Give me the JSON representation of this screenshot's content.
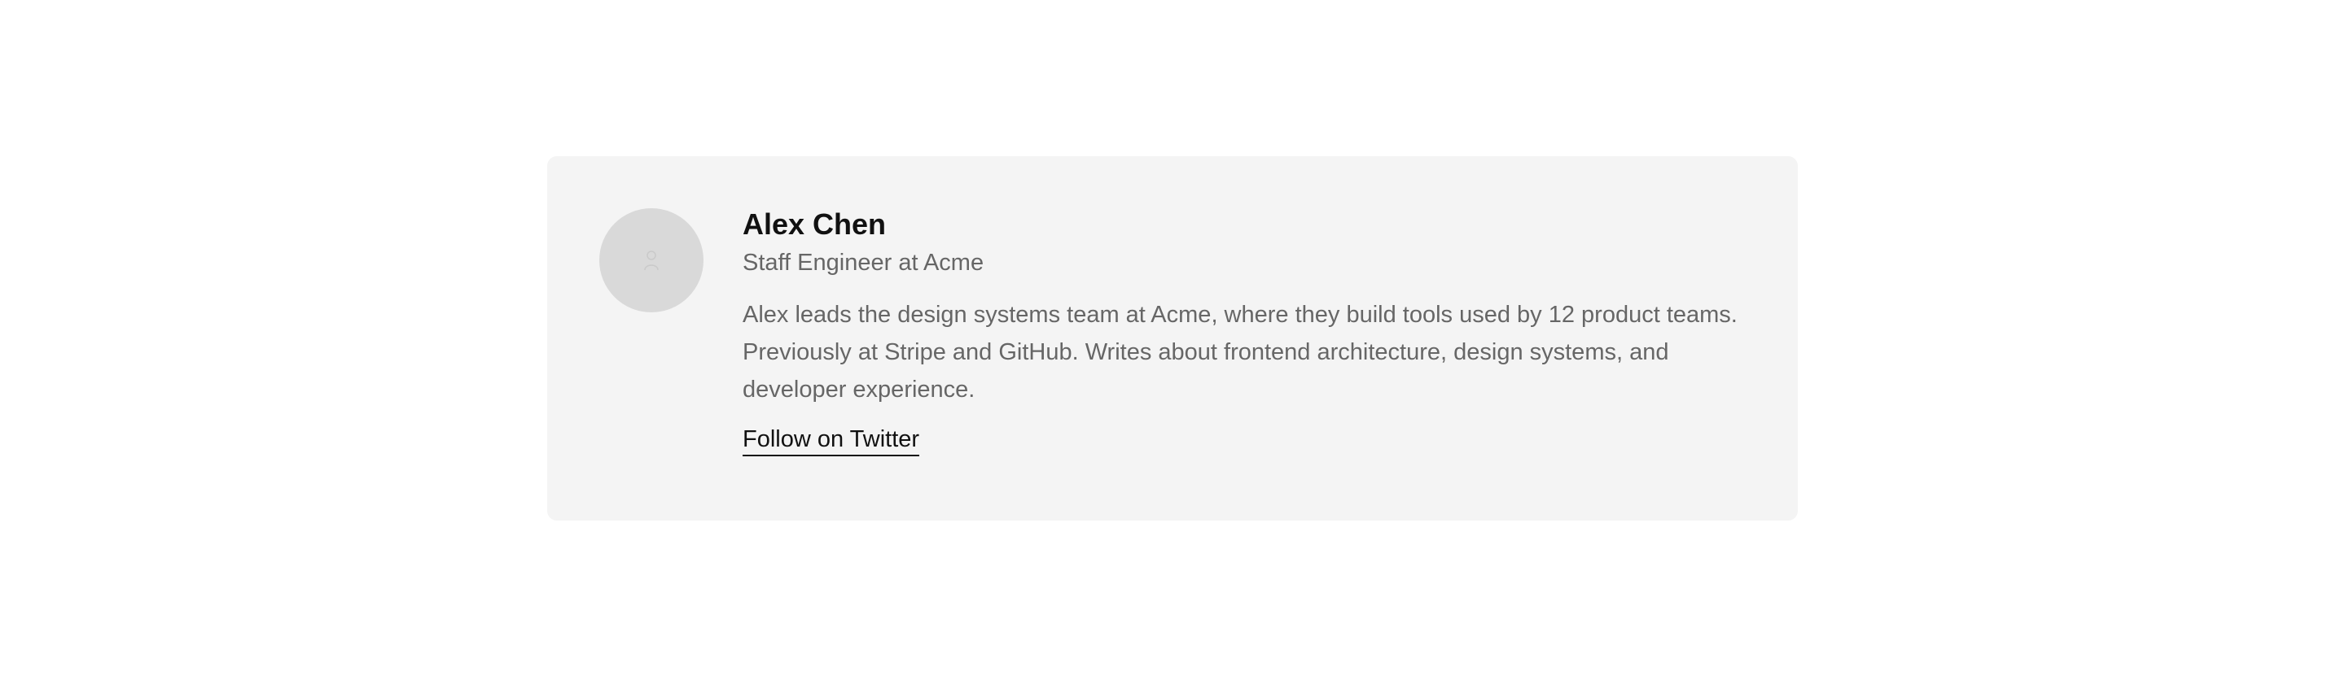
{
  "profile": {
    "avatar_icon": "person-placeholder-icon",
    "name": "Alex Chen",
    "title": "Staff Engineer at Acme",
    "bio": "Alex leads the design systems team at Acme, where they build tools used by 12 product teams. Previously at Stripe and GitHub. Writes about frontend architecture, design systems, and developer experience.",
    "follow_link": "Follow on Twitter"
  },
  "colors": {
    "card_background": "#f4f4f4",
    "avatar_background": "#d9d9d9",
    "primary_text": "#111111",
    "secondary_text": "#666666"
  }
}
